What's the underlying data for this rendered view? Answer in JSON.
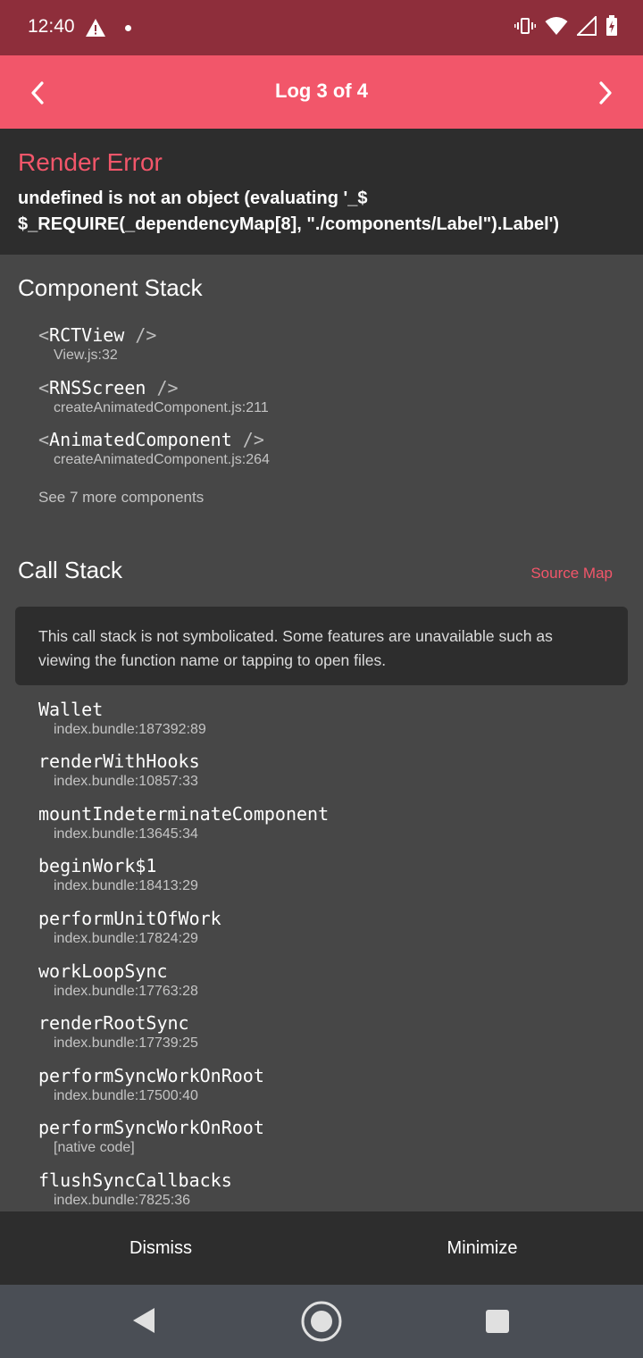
{
  "status_bar": {
    "time": "12:40"
  },
  "header": {
    "title": "Log 3 of 4"
  },
  "error": {
    "title": "Render Error",
    "message_line1": "undefined is not an object (evaluating '_$",
    "message_line2": "$_REQUIRE(_dependencyMap[8], \"./components/Label\").Label')"
  },
  "component_stack": {
    "title": "Component Stack",
    "open_bracket": "<",
    "close_bracket": "/>",
    "items": [
      {
        "name": "RCTView",
        "location": "View.js:32"
      },
      {
        "name": "RNSScreen",
        "location": "createAnimatedComponent.js:211"
      },
      {
        "name": "AnimatedComponent",
        "location": "createAnimatedComponent.js:264"
      }
    ],
    "see_more": "See 7 more components"
  },
  "call_stack": {
    "title": "Call Stack",
    "source_map_label": "Source Map",
    "notice": "This call stack is not symbolicated. Some features are unavailable such as viewing the function name or tapping to open files.",
    "frames": [
      {
        "name": "Wallet",
        "location": "index.bundle:187392:89"
      },
      {
        "name": "renderWithHooks",
        "location": "index.bundle:10857:33"
      },
      {
        "name": "mountIndeterminateComponent",
        "location": "index.bundle:13645:34"
      },
      {
        "name": "beginWork$1",
        "location": "index.bundle:18413:29"
      },
      {
        "name": "performUnitOfWork",
        "location": "index.bundle:17824:29"
      },
      {
        "name": "workLoopSync",
        "location": "index.bundle:17763:28"
      },
      {
        "name": "renderRootSync",
        "location": "index.bundle:17739:25"
      },
      {
        "name": "performSyncWorkOnRoot",
        "location": "index.bundle:17500:40"
      },
      {
        "name": "performSyncWorkOnRoot",
        "location": "[native code]"
      },
      {
        "name": "flushSyncCallbacks",
        "location": "index.bundle:7825:36"
      }
    ]
  },
  "footer": {
    "dismiss_label": "Dismiss",
    "minimize_label": "Minimize"
  },
  "colors": {
    "accent": "#f2566a",
    "status_bar": "#8e2e3b",
    "panel_dark": "#2d2d2d",
    "panel": "#474747"
  }
}
